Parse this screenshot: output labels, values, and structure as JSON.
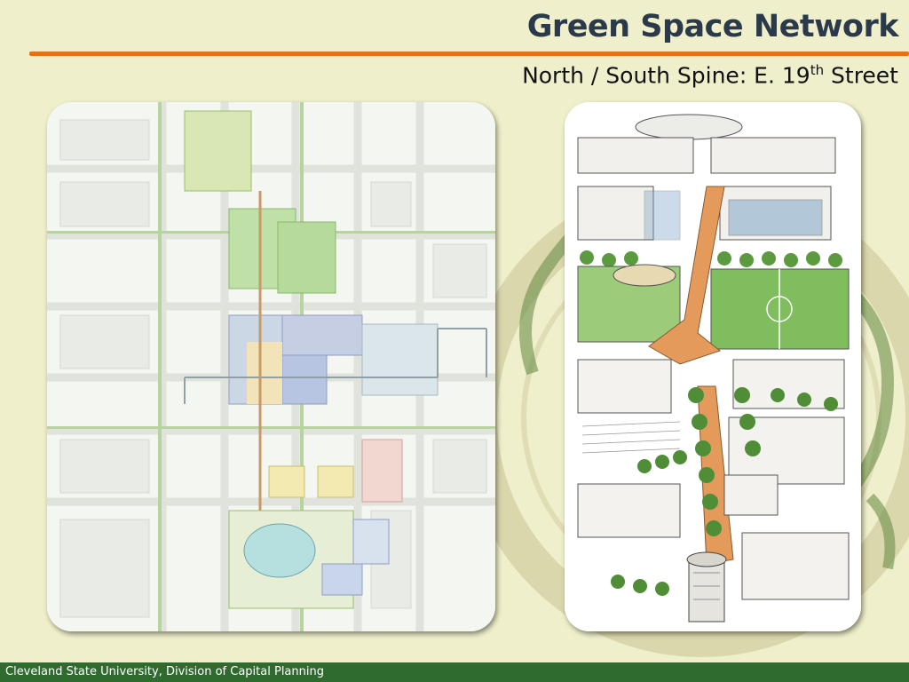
{
  "slide": {
    "title": "Green Space Network",
    "subtitle_prefix": "North / South Spine: E. 19",
    "subtitle_sup": "th",
    "subtitle_suffix": " Street"
  },
  "footer": {
    "text": "Cleveland State University, Division of Capital Planning"
  },
  "colors": {
    "background": "#efefcb",
    "accent_rule": "#e2711d",
    "footer_bar": "#2f6b2e",
    "seal_green": "#6b8f4a"
  },
  "images": {
    "left": "campus-site-plan-image",
    "right": "aerial-perspective-sketch-image"
  }
}
